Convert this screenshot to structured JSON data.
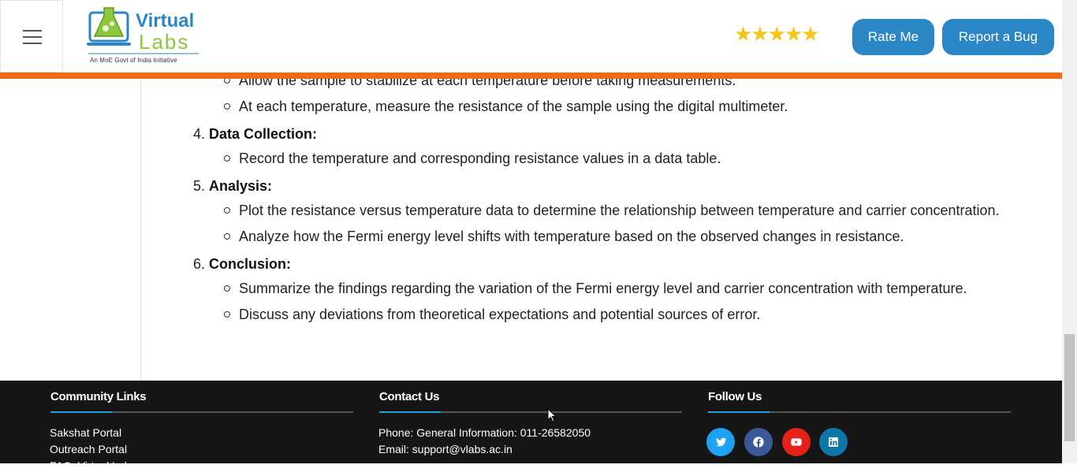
{
  "header": {
    "logo_brand_top": "Virtual",
    "logo_brand_bottom": "Labs",
    "logo_tagline": "An MoE Govt of India Initiative",
    "rating_stars": 5,
    "stars_text": "★★★★★",
    "rate_button": "Rate Me",
    "bug_button": "Report a Bug"
  },
  "content": {
    "partial_bullet": "Allow the sample to stabilize at each temperature before taking measurements.",
    "step3_bullet": "At each temperature, measure the resistance of the sample using the digital multimeter.",
    "sections": [
      {
        "num": "4.",
        "title": "Data Collection:",
        "bullets": [
          "Record the temperature and corresponding resistance values in a data table."
        ]
      },
      {
        "num": "5.",
        "title": "Analysis:",
        "bullets": [
          "Plot the resistance versus temperature data to determine the relationship between temperature and carrier concentration.",
          "Analyze how the Fermi energy level shifts with temperature based on the observed changes in resistance."
        ]
      },
      {
        "num": "6.",
        "title": "Conclusion:",
        "bullets": [
          "Summarize the findings regarding the variation of the Fermi energy level and carrier concentration with temperature.",
          "Discuss any deviations from theoretical expectations and potential sources of error."
        ]
      }
    ]
  },
  "footer": {
    "community_title": "Community Links",
    "community_links": [
      "Sakshat Portal",
      "Outreach Portal",
      "FAQ: Virtual Labs"
    ],
    "contact_title": "Contact Us",
    "contact_phone": "Phone: General Information: 011-26582050",
    "contact_email": "Email: support@vlabs.ac.in",
    "follow_title": "Follow Us",
    "socials": [
      {
        "name": "twitter-icon",
        "color": "#1da1f2"
      },
      {
        "name": "facebook-icon",
        "color": "#3b5998"
      },
      {
        "name": "youtube-icon",
        "color": "#e62117"
      },
      {
        "name": "linkedin-icon",
        "color": "#0e76a8"
      }
    ]
  },
  "colors": {
    "accent_orange": "#ee6d12",
    "button_blue": "#2a86c5",
    "footer_bg": "#161616"
  }
}
